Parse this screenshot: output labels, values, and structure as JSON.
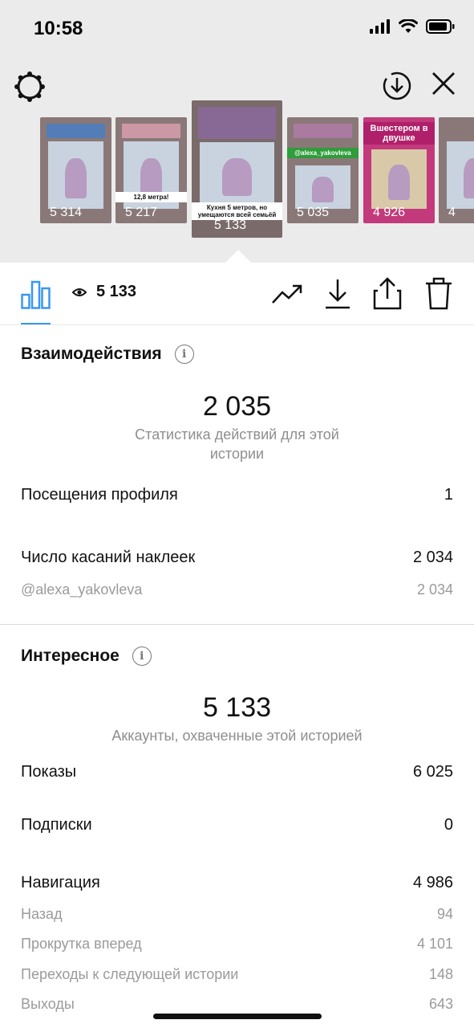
{
  "status_bar": {
    "time": "10:58"
  },
  "thumbnails": [
    {
      "views": "5 314",
      "caption_preview": ""
    },
    {
      "views": "5 217",
      "caption_preview": "12,8 метра!"
    },
    {
      "views": "5 133",
      "caption_preview": "Кухня 5 метров, но умещаются всей семьёй"
    },
    {
      "views": "5 035",
      "caption_preview": "@alexa_yakovleva"
    },
    {
      "views": "4 926",
      "caption_preview": "Вшестером в двушке"
    },
    {
      "views": "4 ",
      "caption_preview": ""
    }
  ],
  "toolbar": {
    "views": "5 133"
  },
  "interactions": {
    "title": "Взаимодействия",
    "total": "2 035",
    "subtitle": "Статистика действий для этой истории",
    "profile_visits_label": "Посещения профиля",
    "profile_visits_value": "1",
    "sticker_taps_label": "Число касаний наклеек",
    "sticker_taps_value": "2 034",
    "sticker_handle": "@alexa_yakovleva",
    "sticker_handle_value": "2 034"
  },
  "discovery": {
    "title": "Интересное",
    "reach": "5 133",
    "subtitle": "Аккаунты, охваченные этой историей",
    "impressions_label": "Показы",
    "impressions_value": "6 025",
    "follows_label": "Подписки",
    "follows_value": "0",
    "navigation_label": "Навигация",
    "navigation_value": "4 986",
    "back_label": "Назад",
    "back_value": "94",
    "forward_label": "Прокрутка вперед",
    "forward_value": "4 101",
    "next_story_label": "Переходы к следующей истории",
    "next_story_value": "148",
    "exits_label": "Выходы",
    "exits_value": "643"
  },
  "colors": {
    "accent": "#3897f0",
    "muted": "#8e8e8e"
  }
}
